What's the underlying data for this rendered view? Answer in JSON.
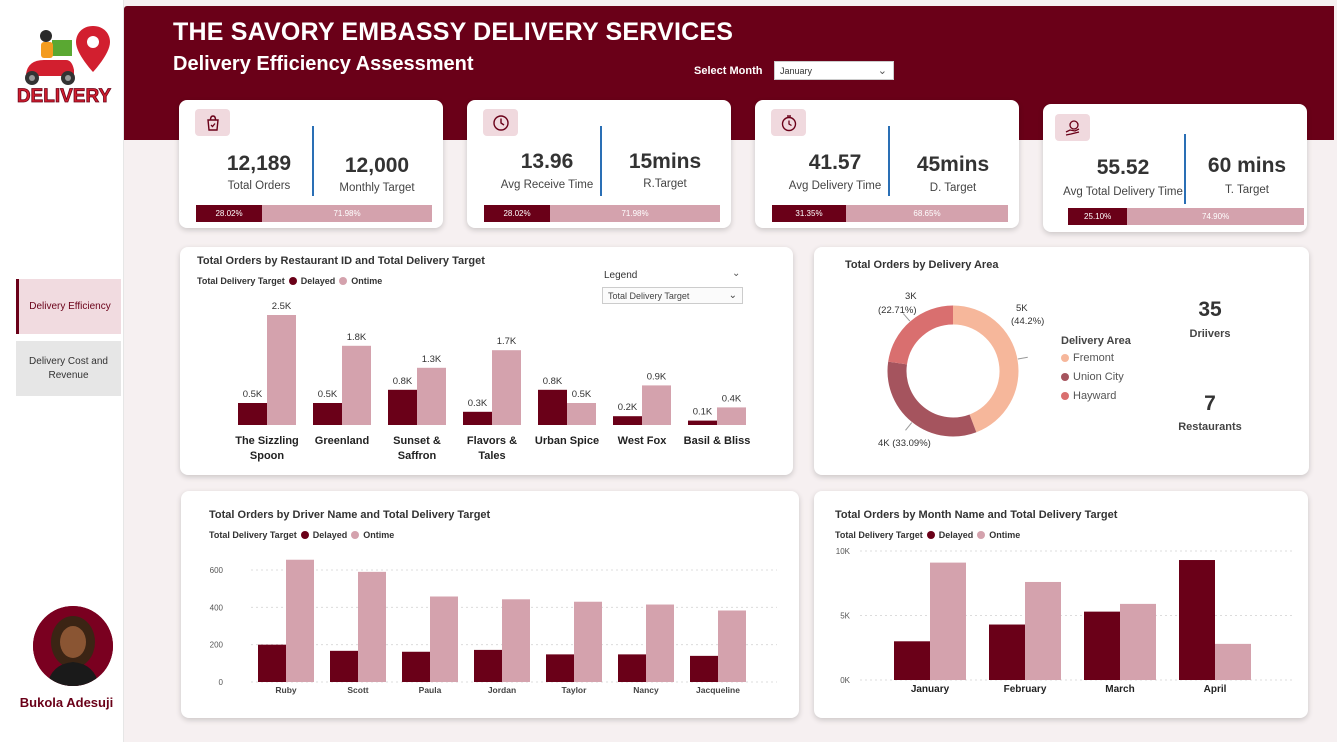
{
  "header": {
    "title": "THE SAVORY EMBASSY DELIVERY SERVICES",
    "subtitle": "Delivery Efficiency Assessment",
    "month_label": "Select Month",
    "month_value": "January"
  },
  "logo": {
    "text": "DELIVERY",
    "icon": "delivery-scooter-icon"
  },
  "nav": {
    "items": [
      {
        "label": "Delivery Efficiency",
        "active": true
      },
      {
        "label": "Delivery Cost and Revenue",
        "active": false
      }
    ]
  },
  "author": {
    "name": "Bukola Adesuji"
  },
  "colors": {
    "brand": "#6a0018",
    "delayed": "#6a0018",
    "ontime": "#d4a2ad",
    "fremont": "#f6b79b",
    "union_city": "#a5545e",
    "hayward": "#d96f6f"
  },
  "kpis": [
    {
      "icon": "shopping-bag-icon",
      "value": "12,189",
      "label": "Total Orders",
      "target_value": "12,000",
      "target_label": "Monthly Target",
      "delayed_pct": "28.02%",
      "ontime_pct": "71.98%",
      "delayed_share": 0.2802
    },
    {
      "icon": "clock-icon",
      "value": "13.96",
      "label": "Avg Receive Time",
      "target_value": "15mins",
      "target_label": "R.Target",
      "delayed_pct": "28.02%",
      "ontime_pct": "71.98%",
      "delayed_share": 0.2802
    },
    {
      "icon": "stopwatch-icon",
      "value": "41.57",
      "label": "Avg Delivery Time",
      "target_value": "45mins",
      "target_label": "D. Target",
      "delayed_pct": "31.35%",
      "ontime_pct": "68.65%",
      "delayed_share": 0.3135
    },
    {
      "icon": "hand-money-icon",
      "value": "55.52",
      "label": "Avg Total Delivery Time",
      "target_value": "60 mins",
      "target_label": "T. Target",
      "delayed_pct": "25.10%",
      "ontime_pct": "74.90%",
      "delayed_share": 0.251
    }
  ],
  "restaurant_panel": {
    "title": "Total Orders by Restaurant ID and Total Delivery Target",
    "legend_title": "Total Delivery Target",
    "legend_delayed": "Delayed",
    "legend_ontime": "Ontime",
    "legend_box_label": "Legend",
    "legend_dropdown_value": "Total Delivery Target"
  },
  "area_panel": {
    "title": "Total Orders by Delivery Area",
    "legend_title": "Delivery Area",
    "labels": {
      "fremont": "5K",
      "fremont_pct": "(44.2%)",
      "union": "4K (33.09%)",
      "hayward": "3K",
      "hayward_pct": "(22.71%)"
    },
    "drivers_value": "35",
    "drivers_label": "Driivers",
    "restaurants_value": "7",
    "restaurants_label": "Restaurants"
  },
  "driver_panel": {
    "title": "Total Orders by Driver Name and Total Delivery Target",
    "legend_title": "Total Delivery Target",
    "legend_delayed": "Delayed",
    "legend_ontime": "Ontime"
  },
  "month_panel": {
    "title": "Total Orders by Month Name and Total Delivery Target",
    "legend_title": "Total Delivery Target",
    "legend_delayed": "Delayed",
    "legend_ontime": "Ontime"
  },
  "chart_data": [
    {
      "type": "bar",
      "title": "Total Orders by Restaurant ID and Total Delivery Target",
      "categories": [
        "The Sizzling Spoon",
        "Greenland",
        "Sunset & Saffron",
        "Flavors & Tales",
        "Urban Spice",
        "West Fox",
        "Basil & Bliss"
      ],
      "category_lines": [
        [
          "The Sizzling",
          "Spoon"
        ],
        [
          "Greenland"
        ],
        [
          "Sunset &",
          "Saffron"
        ],
        [
          "Flavors &",
          "Tales"
        ],
        [
          "Urban Spice"
        ],
        [
          "West Fox"
        ],
        [
          "Basil & Bliss"
        ]
      ],
      "series": [
        {
          "name": "Delayed",
          "values": [
            500,
            500,
            800,
            300,
            800,
            200,
            100
          ],
          "labels": [
            "0.5K",
            "0.5K",
            "0.8K",
            "0.3K",
            "0.8K",
            "0.2K",
            "0.1K"
          ]
        },
        {
          "name": "Ontime",
          "values": [
            2500,
            1800,
            1300,
            1700,
            500,
            900,
            400
          ],
          "labels": [
            "2.5K",
            "1.8K",
            "1.3K",
            "1.7K",
            "0.5K",
            "0.9K",
            "0.4K"
          ]
        }
      ],
      "ylim": [
        0,
        2500
      ]
    },
    {
      "type": "pie",
      "title": "Total Orders by Delivery Area",
      "categories": [
        "Fremont",
        "Union City",
        "Hayward"
      ],
      "values": [
        44.2,
        33.09,
        22.71
      ]
    },
    {
      "type": "bar",
      "title": "Total Orders by Driver Name and Total Delivery Target",
      "categories": [
        "Ruby",
        "Scott",
        "Paula",
        "Jordan",
        "Taylor",
        "Nancy",
        "Jacqueline"
      ],
      "series": [
        {
          "name": "Delayed",
          "values": [
            200,
            167,
            162,
            172,
            148,
            148,
            140
          ]
        },
        {
          "name": "Ontime",
          "values": [
            655,
            590,
            458,
            443,
            430,
            415,
            383
          ]
        }
      ],
      "yticks": [
        "0",
        "200",
        "400",
        "600"
      ],
      "ylim": [
        0,
        650
      ]
    },
    {
      "type": "bar",
      "title": "Total Orders by Month Name and Total Delivery Target",
      "categories": [
        "January",
        "February",
        "March",
        "April"
      ],
      "series": [
        {
          "name": "Delayed",
          "values": [
            3000,
            4300,
            5300,
            9300
          ]
        },
        {
          "name": "Ontime",
          "values": [
            9100,
            7600,
            5900,
            2800
          ]
        }
      ],
      "yticks": [
        "0K",
        "5K",
        "10K"
      ],
      "ylim": [
        0,
        10000
      ]
    }
  ]
}
